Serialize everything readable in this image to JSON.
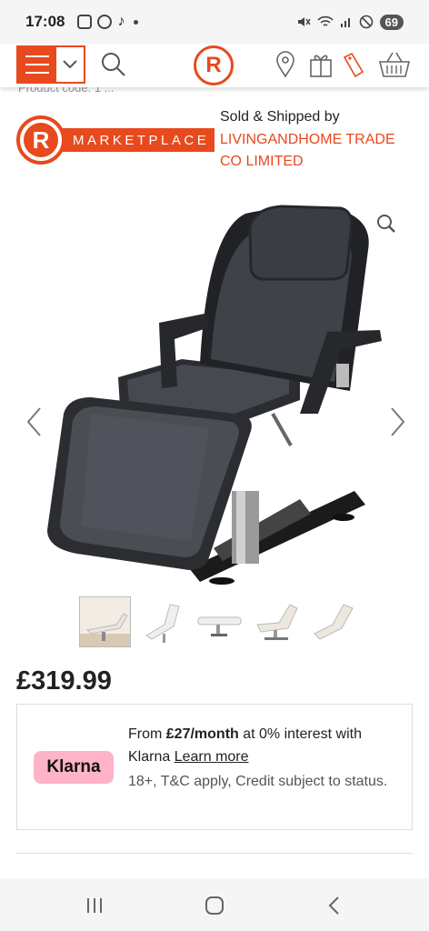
{
  "status_bar": {
    "time": "17:08",
    "battery": "69",
    "left_icons": [
      "shield-icon",
      "fingerprint-icon",
      "tiktok-icon"
    ],
    "right_icons": [
      "mute-icon",
      "wifi-icon",
      "signal-icon",
      "block-icon"
    ]
  },
  "header": {
    "logo_letter": "R",
    "icons": [
      "menu-icon",
      "chevron-down-icon",
      "search-icon",
      "location-pin-icon",
      "gift-icon",
      "price-tag-icon",
      "basket-icon"
    ]
  },
  "seller": {
    "clipped_text": "Product code: 1 ...",
    "marketplace_letter": "R",
    "marketplace_label": "MARKETPLACE",
    "sold_by": "Sold & Shipped by",
    "name": "LIVINGANDHOME TRADE CO LIMITED"
  },
  "gallery": {
    "thumbnail_count": 5,
    "active_index": 0
  },
  "price": "£319.99",
  "klarna": {
    "badge": "Klarna",
    "line_prefix": "From ",
    "amount": "£27/month",
    "line_suffix": " at 0% interest with Klarna ",
    "learn_more": "Learn more",
    "terms": "18+, T&C apply, Credit subject to status."
  },
  "colors": {
    "brand": "#e8491d",
    "klarna_pink": "#ffb3c7"
  }
}
